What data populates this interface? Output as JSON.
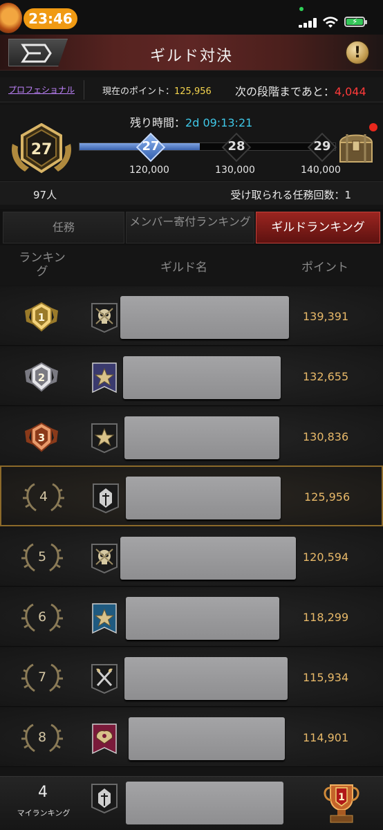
{
  "status_bar": {
    "time": "23:46",
    "icons": [
      "signal-icon",
      "wifi-icon",
      "battery-charging-icon"
    ]
  },
  "header": {
    "title": "ギルド対決",
    "back_icon": "back-arrow-icon",
    "info_icon": "info-exclamation-icon",
    "info_label": "!"
  },
  "info": {
    "tier_link": "プロフェショナル",
    "current_points_label": "現在のポイント：",
    "current_points": "125,956",
    "next_stage_label": "次の段階まであと：",
    "next_stage_remaining": "4,044"
  },
  "progress": {
    "level": "27",
    "remaining_label": "残り時間：",
    "remaining_time": "2d 09:13:21",
    "fill_fraction": 0.47,
    "nodes": [
      {
        "label": "27",
        "points": "120,000",
        "reached": true
      },
      {
        "label": "28",
        "points": "130,000",
        "reached": false
      },
      {
        "label": "29",
        "points": "140,000",
        "reached": false
      }
    ],
    "reward_icon": "treasure-chest-icon"
  },
  "members_row": {
    "members": "97人",
    "tasks_label": "受け取られる任務回数：1"
  },
  "tabs": [
    {
      "label": "任務",
      "active": false
    },
    {
      "label": "メンバー寄付ランキング",
      "active": false
    },
    {
      "label": "ギルドランキング",
      "active": true
    }
  ],
  "columns": {
    "rank": "ランキング",
    "guild_name": "ギルド名",
    "points": "ポイント"
  },
  "rows": [
    {
      "rank": "1",
      "rank_style": "gold-medal",
      "emblem": "skull-emblem-icon",
      "points": "139,391"
    },
    {
      "rank": "2",
      "rank_style": "silver-medal",
      "emblem": "star-banner-purple-icon",
      "points": "132,655"
    },
    {
      "rank": "3",
      "rank_style": "bronze-medal",
      "emblem": "star-shield-icon",
      "points": "130,836"
    },
    {
      "rank": "4",
      "rank_style": "wreath",
      "emblem": "helmet-emblem-icon",
      "points": "125,956",
      "mine": true
    },
    {
      "rank": "5",
      "rank_style": "wreath",
      "emblem": "skull-emblem-icon",
      "points": "120,594"
    },
    {
      "rank": "6",
      "rank_style": "wreath",
      "emblem": "star-banner-blue-icon",
      "points": "118,299"
    },
    {
      "rank": "7",
      "rank_style": "wreath",
      "emblem": "crossed-axes-emblem-icon",
      "points": "115,934"
    },
    {
      "rank": "8",
      "rank_style": "wreath",
      "emblem": "eagle-banner-red-icon",
      "points": "114,901"
    }
  ],
  "bottom": {
    "my_rank": "4",
    "my_rank_label": "マイランキング",
    "emblem": "helmet-emblem-icon",
    "trophy_icon": "trophy-icon",
    "trophy_rank": "1"
  },
  "colors": {
    "accent_red": "#9b2520",
    "points_gold": "#e8b969",
    "link_purple": "#c184ff",
    "time_cyan": "#3fc8e8",
    "warning_red": "#ff3a3a",
    "progress_blue": "#3b63b0"
  }
}
